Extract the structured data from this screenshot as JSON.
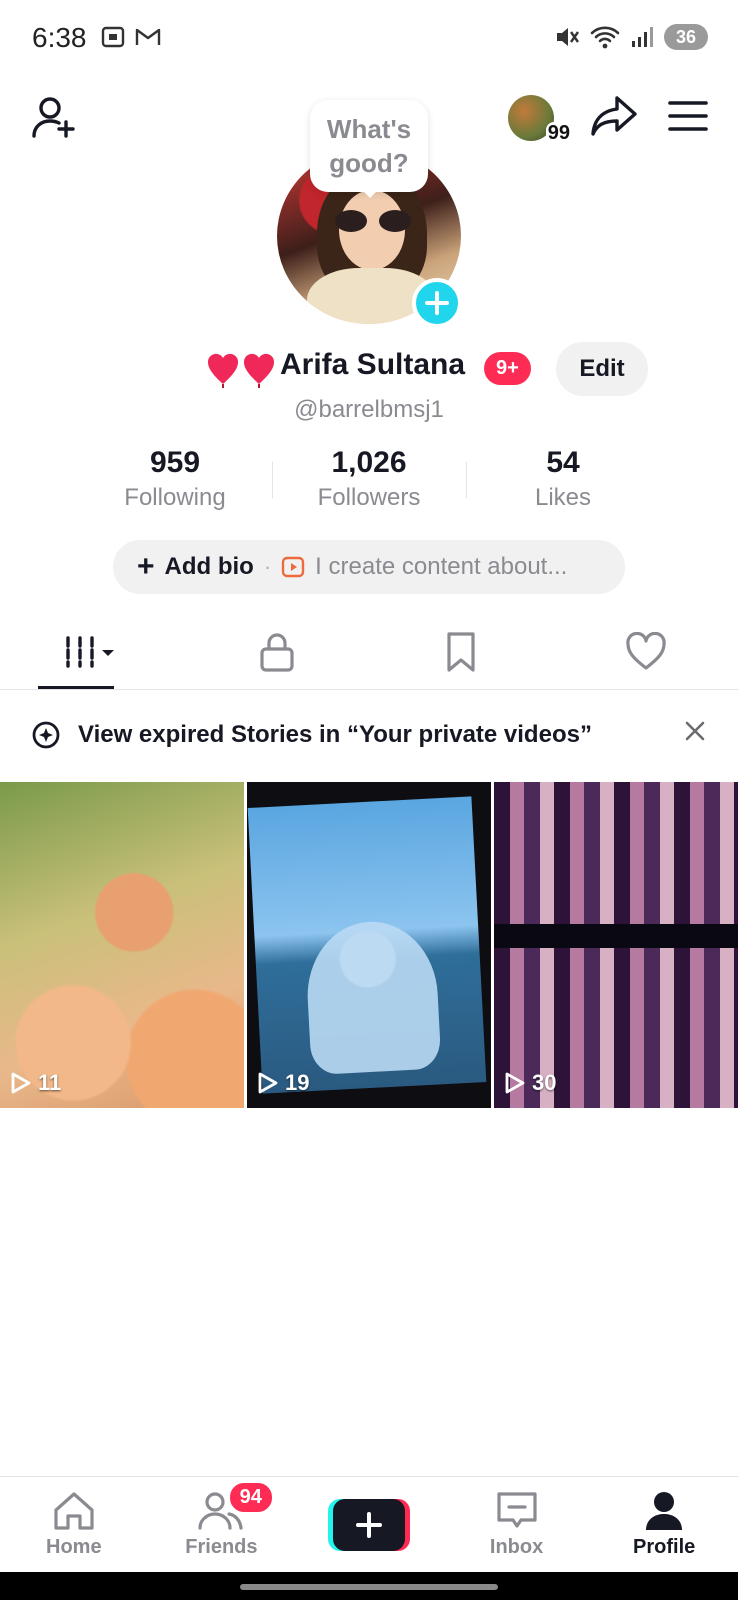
{
  "status_bar": {
    "time": "6:38",
    "battery": "36",
    "icons": [
      "screenshot-icon",
      "gmail-icon",
      "mute-icon",
      "wifi-icon",
      "signal-icon",
      "battery-icon"
    ]
  },
  "top_nav": {
    "story_count": "99",
    "icons": [
      "add-friend-icon",
      "share-icon",
      "menu-icon"
    ]
  },
  "profile": {
    "bubble_line1": "What's",
    "bubble_line2": "good?",
    "name": "Arifa Sultana",
    "name_badge": "9+",
    "edit_label": "Edit",
    "username": "@barrelbmsj1"
  },
  "stats": [
    {
      "value": "959",
      "label": "Following"
    },
    {
      "value": "1,026",
      "label": "Followers"
    },
    {
      "value": "54",
      "label": "Likes"
    }
  ],
  "bio": {
    "add_label": "Add bio",
    "separator": "·",
    "hint": "I create content about..."
  },
  "tabs": [
    "videos",
    "private",
    "saved",
    "liked"
  ],
  "banner": {
    "text": "View expired Stories in “Your private videos”"
  },
  "videos": [
    {
      "views": "11"
    },
    {
      "views": "19"
    },
    {
      "views": "30"
    }
  ],
  "bottom_nav": {
    "home": "Home",
    "friends": "Friends",
    "friends_badge": "94",
    "inbox": "Inbox",
    "profile": "Profile"
  },
  "colors": {
    "accent_red": "#fe2c55",
    "accent_cyan": "#25f4ee",
    "add_button": "#20d5ec",
    "text_primary": "#161823",
    "text_secondary": "#8a8b91"
  }
}
